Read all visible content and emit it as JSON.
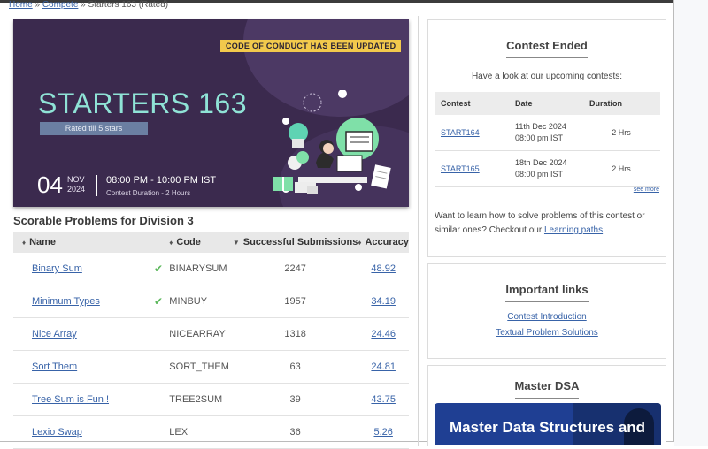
{
  "breadcrumb": {
    "home": "Home",
    "compete": "Compete",
    "sep": "»",
    "current": "Starters 163 (Rated)"
  },
  "banner": {
    "notice": "CODE OF CONDUCT HAS BEEN UPDATED",
    "title": "STARTERS 163",
    "rated": "Rated till 5 stars",
    "day": "04",
    "month": "NOV",
    "year": "2024",
    "time": "08:00 PM - 10:00 PM IST",
    "duration": "Contest Duration - 2 Hours"
  },
  "problems": {
    "title": "Scorable Problems for Division 3",
    "headers": {
      "name": "Name",
      "code": "Code",
      "subs": "Successful Submissions",
      "acc": "Accuracy"
    },
    "rows": [
      {
        "name": "Binary Sum",
        "solved": "✔",
        "code": "BINARYSUM",
        "subs": "2247",
        "acc": "48.92"
      },
      {
        "name": "Minimum Types",
        "solved": "✔",
        "code": "MINBUY",
        "subs": "1957",
        "acc": "34.19"
      },
      {
        "name": "Nice Array",
        "solved": "",
        "code": "NICEARRAY",
        "subs": "1318",
        "acc": "24.46"
      },
      {
        "name": "Sort Them",
        "solved": "",
        "code": "SORT_THEM",
        "subs": "63",
        "acc": "24.81"
      },
      {
        "name": "Tree Sum is Fun !",
        "solved": "",
        "code": "TREE2SUM",
        "subs": "39",
        "acc": "43.75"
      },
      {
        "name": "Lexio Swap",
        "solved": "",
        "code": "LEX",
        "subs": "36",
        "acc": "5.26"
      }
    ]
  },
  "contest_ended": {
    "title": "Contest Ended",
    "subtitle": "Have a look at our upcoming contests:",
    "headers": {
      "contest": "Contest",
      "date": "Date",
      "duration": "Duration"
    },
    "rows": [
      {
        "contest": "START164",
        "date": "11th Dec 2024",
        "time": "08:00 pm IST",
        "duration": "2 Hrs"
      },
      {
        "contest": "START165",
        "date": "18th Dec 2024",
        "time": "08:00 pm IST",
        "duration": "2 Hrs"
      }
    ],
    "see_more": "see more",
    "learn_text": "Want to learn how to solve problems of this contest or similar ones? Checkout our",
    "learn_link": "Learning paths"
  },
  "important_links": {
    "title": "Important links",
    "links": [
      "Contest Introduction",
      "Textual Problem Solutions"
    ]
  },
  "master_dsa": {
    "title": "Master DSA",
    "promo": "Master Data Structures and"
  },
  "colors": {
    "banner_bg": "#3b2a4e",
    "title_teal": "#8fe3d6",
    "link": "#3863a8",
    "notice": "#f2c94c"
  }
}
